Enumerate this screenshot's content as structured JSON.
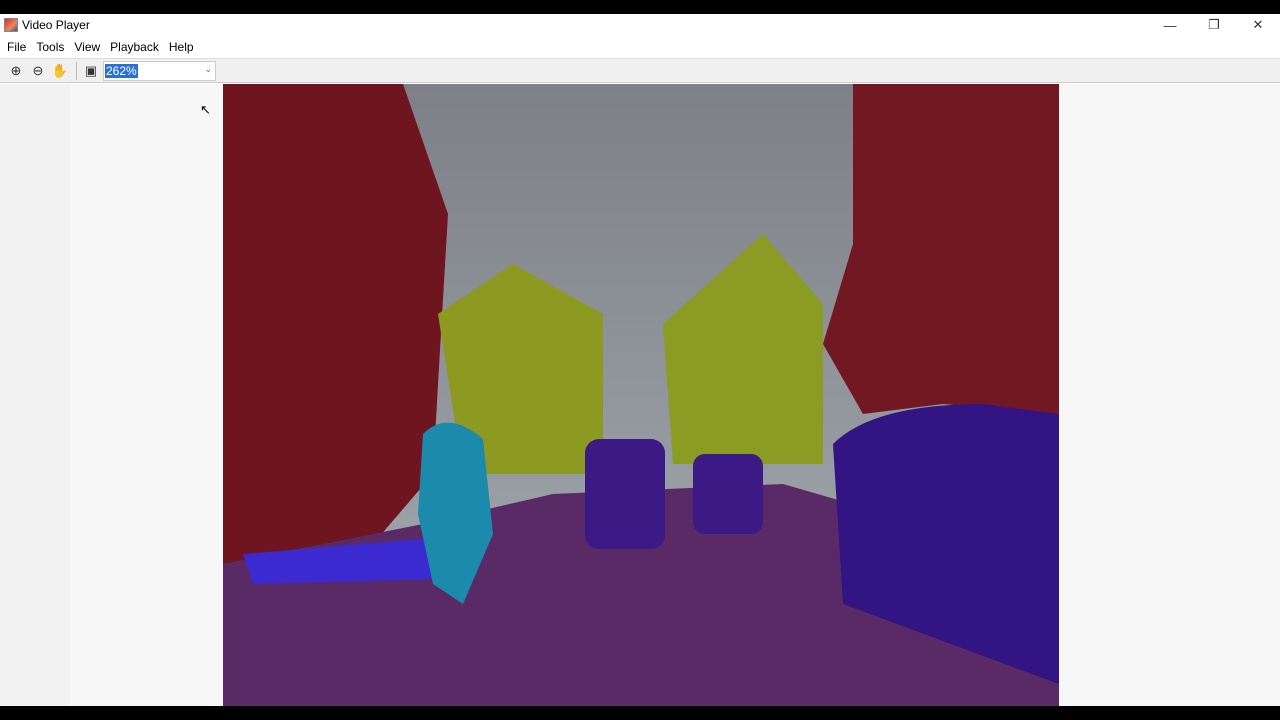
{
  "window": {
    "title": "Video Player",
    "minimize_icon": "minimize-icon",
    "restore_icon": "restore-icon",
    "close_icon": "close-icon"
  },
  "menu": [
    "File",
    "Tools",
    "View",
    "Playback",
    "Help"
  ],
  "toolbar": {
    "zoom": "262%"
  },
  "video": {
    "description_colors": {
      "building": "#7a1620",
      "sky": "#8a8d93",
      "vegetation": "#8a9a1e",
      "road": "#5a2a6a",
      "car": "#3a1a8a",
      "pedestrian": "#1a8aa8",
      "sidewalk": "#3a2ad0"
    }
  }
}
